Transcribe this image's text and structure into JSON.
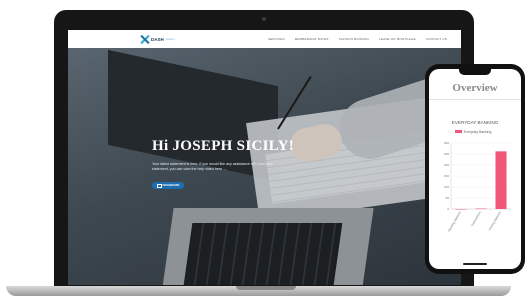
{
  "site": {
    "logo_text": "DASH",
    "logo_sub": "banking",
    "nav": [
      "SERVICES",
      "MEMBERSHIP RATES",
      "SAVINGS BANKING",
      "LEASE OR MORTGAGE",
      "CONTACT US"
    ]
  },
  "hero": {
    "greeting": "Hi JOSEPH SICILY!",
    "message": "Your latest statement is here. If you would like any assistance with your new statement, you can view the help video here →",
    "button_label": "DASHBOARD"
  },
  "phone": {
    "title": "Overview"
  },
  "colors": {
    "accent": "#1f6fb0",
    "bar": "#f2557a"
  },
  "chart_data": {
    "type": "bar",
    "title": "EVERYDAY BANKING",
    "legend": [
      "Everyday Banking"
    ],
    "legend_position": "top",
    "categories": [
      "Opening Balance",
      "Transactions",
      "Closing Balance"
    ],
    "series": [
      {
        "name": "Everyday Banking",
        "values": [
          0,
          2,
          262
        ]
      }
    ],
    "y_ticks": [
      "0",
      "50",
      "100",
      "150",
      "200",
      "250",
      "300"
    ],
    "ylim": [
      0,
      300
    ],
    "grid": true
  }
}
